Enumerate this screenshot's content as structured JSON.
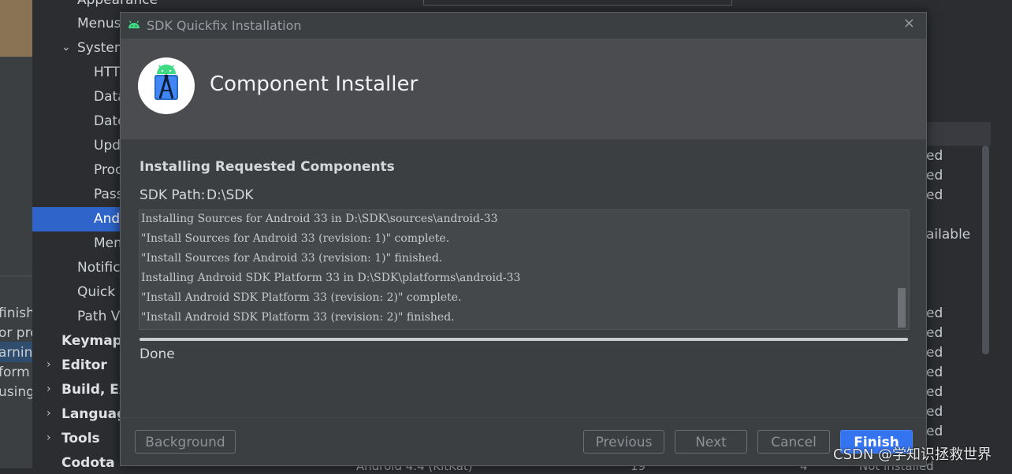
{
  "colors": {
    "accent": "#3574f0",
    "selection": "#2f65ca",
    "dialog_bg": "#3c3f41",
    "header_bg": "#4a4c4f"
  },
  "left_edge_fragments": [
    "finishe",
    "or pro",
    "arnin",
    "form",
    "using"
  ],
  "settings_tree": {
    "items": [
      {
        "label": "Appearance",
        "indent": 2
      },
      {
        "label": "Menus",
        "indent": 2
      },
      {
        "label": "System",
        "indent": 2,
        "expanded": true
      },
      {
        "label": "HTTI",
        "indent": 3
      },
      {
        "label": "Data",
        "indent": 3
      },
      {
        "label": "Date",
        "indent": 3
      },
      {
        "label": "Upda",
        "indent": 3
      },
      {
        "label": "Proc",
        "indent": 3
      },
      {
        "label": "Pass",
        "indent": 3
      },
      {
        "label": "Andr",
        "indent": 3,
        "selected": true
      },
      {
        "label": "Mem",
        "indent": 3
      },
      {
        "label": "Notifica",
        "indent": 2
      },
      {
        "label": "Quick L",
        "indent": 2
      },
      {
        "label": "Path Va",
        "indent": 2
      },
      {
        "label": "Keymap",
        "indent": 1
      },
      {
        "label": "Editor",
        "indent": 1,
        "collapsed": true
      },
      {
        "label": "Build, Exe",
        "indent": 1,
        "collapsed": true
      },
      {
        "label": "Language",
        "indent": 1,
        "collapsed": true
      },
      {
        "label": "Tools",
        "indent": 1,
        "collapsed": true
      },
      {
        "label": "Codota",
        "indent": 1
      }
    ]
  },
  "background_table": {
    "cells": [
      "ed",
      "ed",
      "ed",
      "ailable",
      "ed",
      "ed",
      "ed",
      "ed",
      "ed",
      "ed",
      "ed"
    ],
    "bottom_row": [
      "Android 4.4 (KitKat)",
      "19",
      "4",
      "Not installed"
    ]
  },
  "dialog": {
    "title": "SDK Quickfix Installation",
    "close_icon": "close-icon",
    "header_title": "Component Installer",
    "section_title": "Installing Requested Components",
    "sdk_path_label": "SDK Path:",
    "sdk_path_value": "D:\\SDK",
    "log_lines": [
      "Installing Sources for Android 33 in D:\\SDK\\sources\\android-33",
      "\"Install Sources for Android 33 (revision: 1)\" complete.",
      "\"Install Sources for Android 33 (revision: 1)\" finished.",
      "Installing Android SDK Platform 33 in D:\\SDK\\platforms\\android-33",
      "\"Install Android SDK Platform 33 (revision: 2)\" complete.",
      "\"Install Android SDK Platform 33 (revision: 2)\" finished."
    ],
    "progress": 1.0,
    "status": "Done",
    "buttons": {
      "background": "Background",
      "previous": "Previous",
      "next": "Next",
      "cancel": "Cancel",
      "finish": "Finish"
    }
  },
  "watermark": "CSDN @学知识拯救世界"
}
